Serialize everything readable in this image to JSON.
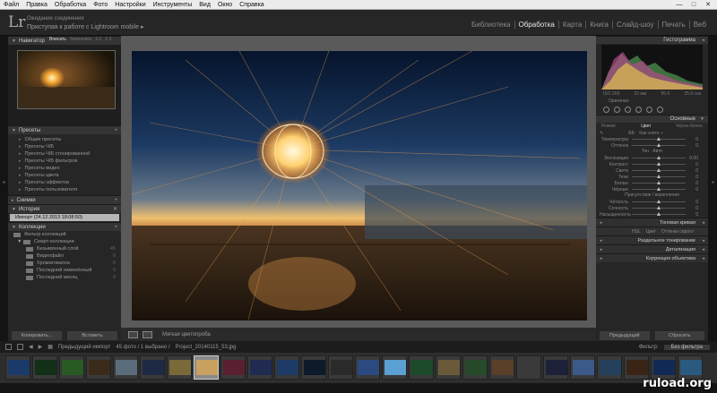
{
  "menu": [
    "Файл",
    "Правка",
    "Обработка",
    "Фото",
    "Настройки",
    "Инструменты",
    "Вид",
    "Окно",
    "Справка"
  ],
  "window_controls": [
    "minimize-icon",
    "maximize-icon",
    "close-icon"
  ],
  "identity": {
    "logo": "Lr",
    "subtitle": "Ожидание соединения",
    "title": "Приступая к работе с Lightroom mobile"
  },
  "modules": [
    {
      "label": "Библиотека",
      "active": false
    },
    {
      "label": "Обработка",
      "active": true
    },
    {
      "label": "Карта",
      "active": false
    },
    {
      "label": "Книга",
      "active": false
    },
    {
      "label": "Слайд-шоу",
      "active": false
    },
    {
      "label": "Печать",
      "active": false
    },
    {
      "label": "Веб",
      "active": false
    }
  ],
  "left": {
    "navigator": {
      "title": "Навигатор",
      "options": [
        "Вписать",
        "Заполнить",
        "1:1",
        "1:3"
      ]
    },
    "presets": {
      "title": "Пресеты",
      "items": [
        "Общие пресеты",
        "Пресеты Ч/Б",
        "Пресеты Ч/Б стонированной",
        "Пресеты Ч/Б фильтров",
        "Пресеты видео",
        "Пресеты цвета",
        "Пресеты эффектов",
        "Пресеты пользователя"
      ]
    },
    "snapshots": {
      "title": "Снимки"
    },
    "history": {
      "title": "История",
      "items": [
        "Импорт (24.12.2013 18:08:50)"
      ]
    },
    "collections": {
      "title": "Коллекции",
      "filter": "Фильтр коллекций",
      "smart": "Смарт-коллекции",
      "items": [
        {
          "label": "Безымянный слой",
          "count": "45"
        },
        {
          "label": "Видеофайл",
          "count": "0"
        },
        {
          "label": "Хроматоматка",
          "count": "0"
        },
        {
          "label": "Последний изменённый",
          "count": "0"
        },
        {
          "label": "Последний месяц",
          "count": "0"
        }
      ]
    },
    "buttons": [
      "Копировать...",
      "Вставить"
    ]
  },
  "toolbar": {
    "soft_proof": "Мягкая цветопроба"
  },
  "right": {
    "histogram": {
      "title": "Гистограмма",
      "info": [
        "ISO 200",
        "22 мм",
        "f/5.6",
        "25.0 сек"
      ],
      "original": "Оригинал"
    },
    "basic": {
      "title": "Основные",
      "tabs": [
        "Режим:",
        "Цвет",
        "Чёрно-белое"
      ],
      "wb_label": "ББ:",
      "wb_value": "Как снято ÷",
      "tone_label": "Тон",
      "auto": "Авто",
      "presence": "Присутствие / вкрапления",
      "sliders": [
        {
          "label": "Температура",
          "value": "0",
          "pos": 0.5
        },
        {
          "label": "Оттенок",
          "value": "0",
          "pos": 0.5
        },
        {
          "label": "Экспозиция",
          "value": "0.00",
          "pos": 0.5
        },
        {
          "label": "Контраст",
          "value": "0",
          "pos": 0.5
        },
        {
          "label": "Света",
          "value": "0",
          "pos": 0.5
        },
        {
          "label": "Тени",
          "value": "0",
          "pos": 0.5
        },
        {
          "label": "Белые",
          "value": "0",
          "pos": 0.5
        },
        {
          "label": "Чёрные",
          "value": "0",
          "pos": 0.5
        },
        {
          "label": "Чёткость",
          "value": "0",
          "pos": 0.5
        },
        {
          "label": "Сочность",
          "value": "0",
          "pos": 0.5
        },
        {
          "label": "Насыщенность",
          "value": "0",
          "pos": 0.5
        }
      ]
    },
    "panels": [
      "Тоновая кривая",
      "Раздельное тонирование",
      "Детализация",
      "Коррекция объектива"
    ],
    "hsl": [
      "HSL",
      "Цвет",
      "Оттенки серого"
    ],
    "buttons": [
      "Предыдущий",
      "Сбросить"
    ]
  },
  "filmstrip_bar": {
    "text": "Предыдущий импорт",
    "count": "45 фото / 1 выбрано /",
    "file": "Project_20140115_53.jpg",
    "filter_label": "Фильтр:",
    "filter_value": "Без фильтра"
  },
  "filmstrip_colors": [
    "#1a3a6a",
    "#123018",
    "#2a5a24",
    "#3a2a1a",
    "#5b6c7a",
    "#1e2a44",
    "#7a6a3a",
    "#c8a060",
    "#5a2030",
    "#202b52",
    "#1e3a66",
    "#0e1a2a",
    "#2a2a2a",
    "#2b4a80",
    "#5aa0d0",
    "#1b4a2a",
    "#6a5a3a",
    "#264a2a",
    "#5a4028",
    "#3a3a3a",
    "#1c2038",
    "#3b5a8a",
    "#24405a",
    "#3a2416",
    "#112a55",
    "#2a5a80"
  ],
  "watermark": "ruload.org"
}
